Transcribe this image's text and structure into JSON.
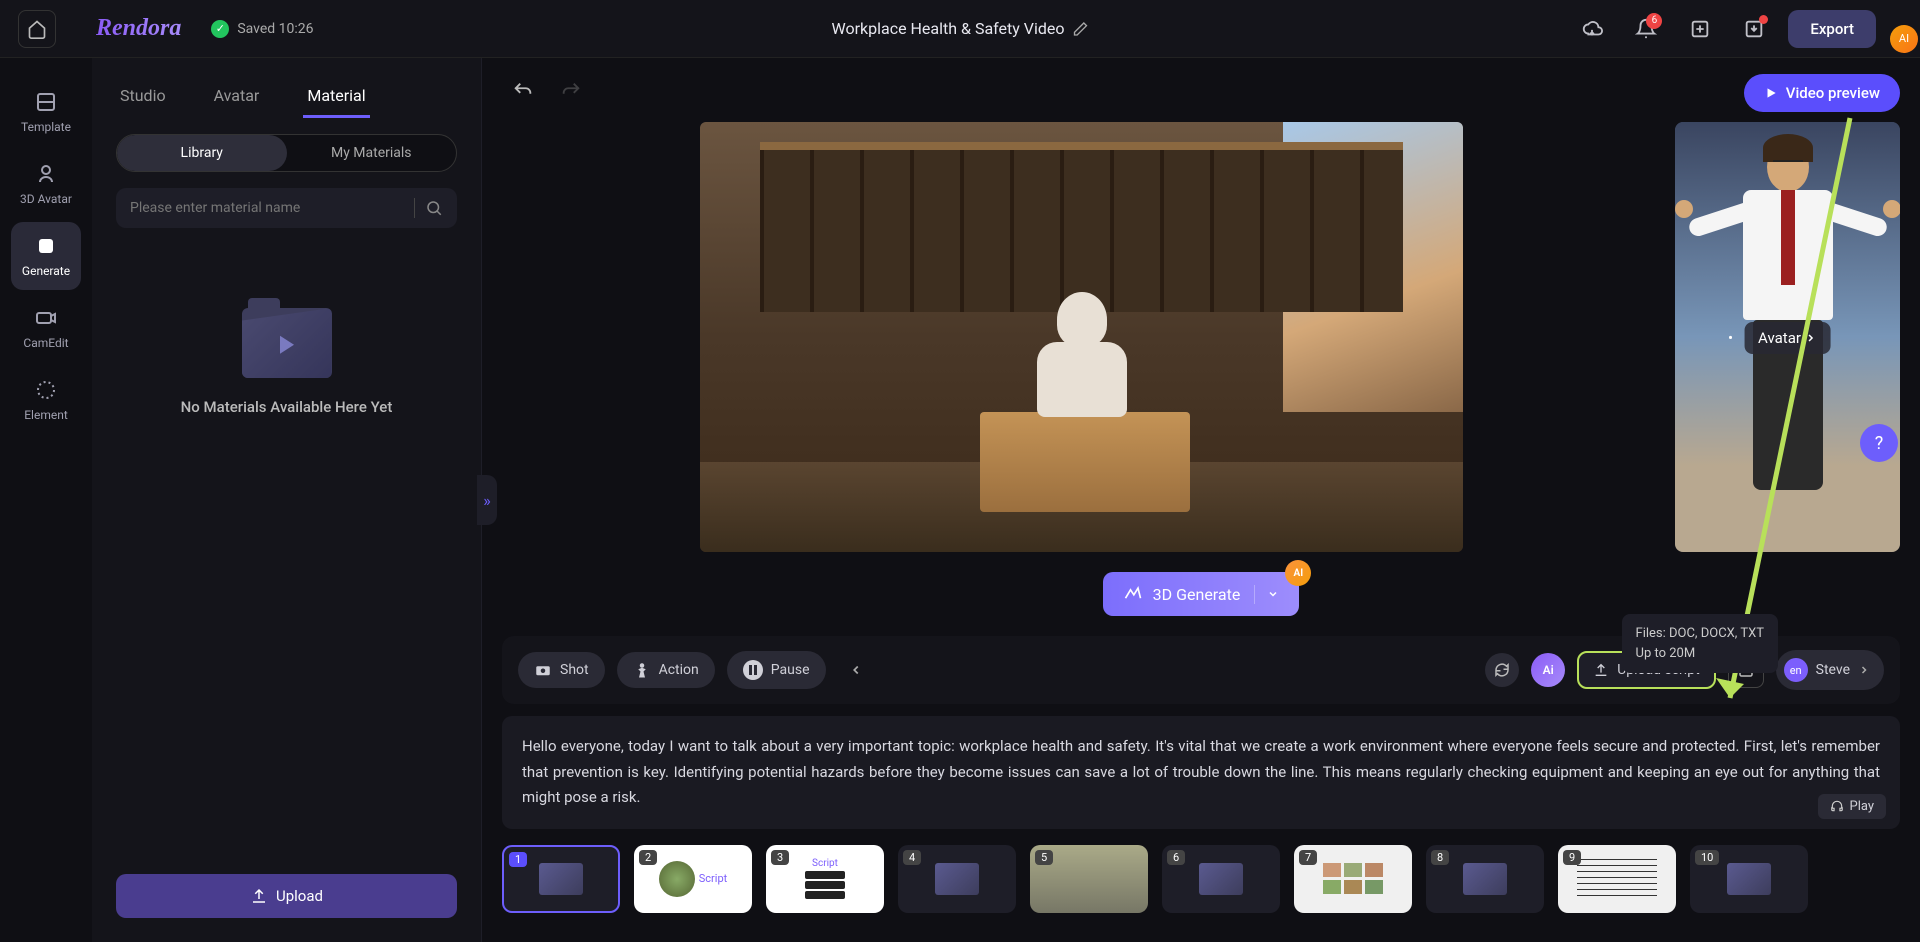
{
  "topbar": {
    "logo": "Rendora",
    "saved_label": "Saved 10:26",
    "project_title": "Workplace Health & Safety Video",
    "notification_count": "6",
    "export_label": "Export"
  },
  "left_nav": {
    "items": [
      {
        "label": "Template"
      },
      {
        "label": "3D Avatar"
      },
      {
        "label": "Generate"
      },
      {
        "label": "CamEdit"
      },
      {
        "label": "Element"
      }
    ]
  },
  "side_panel": {
    "tabs": {
      "studio": "Studio",
      "avatar": "Avatar",
      "material": "Material"
    },
    "subtabs": {
      "library": "Library",
      "my": "My Materials"
    },
    "search_placeholder": "Please enter material name",
    "empty": "No Materials Available Here Yet",
    "upload": "Upload"
  },
  "canvas": {
    "preview": "Video preview",
    "avatar_label": "Avatar",
    "generate": "3D Generate"
  },
  "tooltip": {
    "line1": "Files: DOC, DOCX, TXT",
    "line2": "Up to 20M"
  },
  "toolbar": {
    "shot": "Shot",
    "action": "Action",
    "pause": "Pause",
    "upload_script": "Upload script",
    "voice_lang": "en",
    "voice_name": "Steve",
    "play": "Play"
  },
  "script": "Hello everyone, today I want to talk about a very important topic: workplace health and safety. It's vital that we create a work environment where everyone feels secure and protected. First, let's remember that prevention is key. Identifying potential hazards before they become issues can save a lot of trouble down the line. This means regularly checking equipment and keeping an eye out for anything that might pose a risk.",
  "thumbs": [
    {
      "n": "1"
    },
    {
      "n": "2",
      "script": "Script"
    },
    {
      "n": "3",
      "script": "Script"
    },
    {
      "n": "4"
    },
    {
      "n": "5"
    },
    {
      "n": "6"
    },
    {
      "n": "7"
    },
    {
      "n": "8"
    },
    {
      "n": "9"
    },
    {
      "n": "10"
    }
  ],
  "help": "?"
}
